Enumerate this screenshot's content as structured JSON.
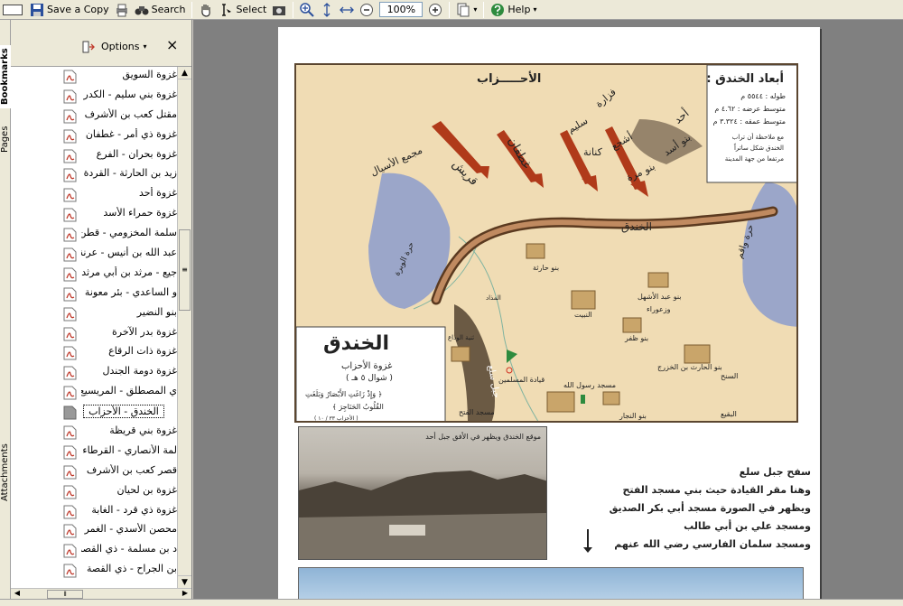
{
  "toolbar": {
    "save_label": "Save a Copy",
    "search_label": "Search",
    "select_label": "Select",
    "zoom_value": "100%",
    "help_label": "Help"
  },
  "side_tabs": {
    "bookmarks": "Bookmarks",
    "pages": "Pages",
    "attachments": "Attachments"
  },
  "panel": {
    "options_label": "Options",
    "close_glyph": "×"
  },
  "bookmarks": [
    {
      "label": "غزوة السويق"
    },
    {
      "label": "غزوة بني سليم - الكدر"
    },
    {
      "label": "مقتل كعب بن الأشرف"
    },
    {
      "label": "غزوة ذي أمر - غطفان"
    },
    {
      "label": "غزوة بحران - الفرع"
    },
    {
      "label": "زيد بن الحارثة - القردة"
    },
    {
      "label": "غزوة أحد"
    },
    {
      "label": "غزوة حمراء الأسد"
    },
    {
      "label": "سلمة المخزومي - قطن"
    },
    {
      "label": "عبد الله بن أنيس - عرنة"
    },
    {
      "label": "جيع - مرثد بن أبي مرثد"
    },
    {
      "label": "و الساعدي - بئر معونة"
    },
    {
      "label": "بنو النضير"
    },
    {
      "label": "غزوة بدر الآخرة"
    },
    {
      "label": "غزوة ذات الرقاع"
    },
    {
      "label": "غزوة دومة الجندل"
    },
    {
      "label": "ي المصطلق - المريسيع"
    },
    {
      "label": "الخندق - الأحزاب",
      "selected": true
    },
    {
      "label": "غزوة بني قريظة"
    },
    {
      "label": "لمة الأنصاري - القرطاء"
    },
    {
      "label": "قصر كعب بن الأشرف"
    },
    {
      "label": "غزوة بن لحيان"
    },
    {
      "label": "غزوة ذي قرد - الغابة"
    },
    {
      "label": "محصن الأسدي - الغمر"
    },
    {
      "label": "د بن مسلمة - ذي القصة"
    },
    {
      "label": "بن الجراح - ذي القصة"
    }
  ],
  "map": {
    "dims_title": "أبعاد الخندق :",
    "dims_lines": [
      "طوله : ٥٥٤٤ م",
      "متوسط عرضه : ٤.٦٢ م",
      "متوسط عمقه : ٣.٣٢٤ م"
    ],
    "dims_note": [
      "مع ملاحظة أن تراب",
      "الخندق شكل ساتراً",
      "مرتفعا من جهة المدينة"
    ],
    "ahzab": "الأحـــــزاب",
    "tribes": [
      "قريش",
      "غطفان",
      "سليم",
      "فزارة",
      "أشجع",
      "كنانة",
      "بنو أسد",
      "بنو مرة",
      "أحد"
    ],
    "places": [
      "مجمع الأسيال",
      "حرة الوبرة",
      "الخندق",
      "حرة واقم",
      "بنو حارثة",
      "بنو عبد الأشهل",
      "وزعوراء",
      "النبيت",
      "بنو ظفر",
      "بنو الحارث بن الخزرج",
      "قيادة المسلمين",
      "مسجد رسول الله",
      "بنو النجار",
      "ثنية الوداع",
      "مسجد الفتح",
      "جبل سلع",
      "السنح",
      "البقيع",
      "المذاد"
    ],
    "legend_title": "الخندق",
    "legend_sub": "غزوة الأحزاب",
    "legend_date": "( شوال ٥ هـ )",
    "legend_verse": [
      "﴿ وَإِذْ زَاغَتِ الأَبْصَارُ وَبَلَغَتِ",
      "القُلُوبُ الحَنَاجِرَ ﴾"
    ],
    "legend_ref": "( الأحزاب ٣٣ / ١٠ )"
  },
  "photo_caption": "موقع الخندق ويظهر في الأفق جبل أحد",
  "description": [
    "سفح جبل سلع",
    "وهنا مقر القيادة حيث بني مسجد الفتح",
    "ويظهر في الصورة مسجد أبي بكر الصديق",
    "ومسجد علي بن أبي طالب",
    "ومسجد سلمان الفارسي رضي الله عنهم"
  ],
  "colors": {
    "map_bg": "#f0dcb4",
    "lava": "#8c9ccc",
    "trench": "#a0522d",
    "arrows": "#b03a1a"
  }
}
